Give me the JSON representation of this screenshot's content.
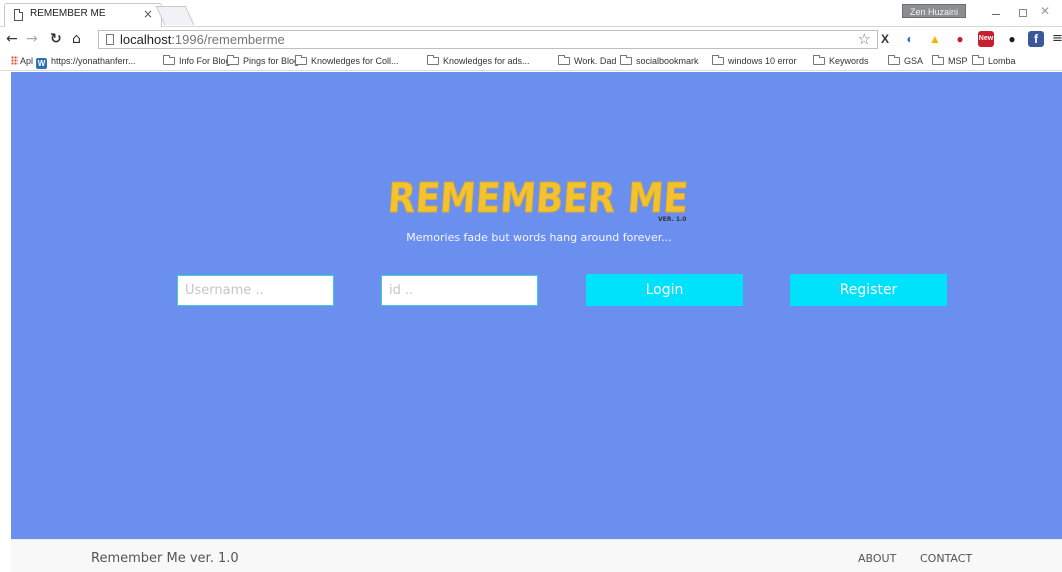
{
  "browser": {
    "tab_title": "REMEMBER ME",
    "tab_close": "×",
    "profile_name": "Zen Huzaini",
    "url_host": "localhost",
    "url_path": ":1996/rememberme",
    "extensions": [
      {
        "icon": "x-extension-icon",
        "glyph": "X",
        "color": "#333333"
      },
      {
        "icon": "user-extension-icon",
        "glyph": "◐",
        "color": "#2a6fd1"
      },
      {
        "icon": "google-drive-icon",
        "glyph": "▲",
        "color": "#f4b400"
      },
      {
        "icon": "ublock-shield-icon",
        "glyph": "●",
        "color": "#c81e2c"
      },
      {
        "icon": "new-extension-icon",
        "glyph": "New",
        "color": "#c81e2c"
      },
      {
        "icon": "color-wheel-icon",
        "glyph": "●",
        "color": "#1e1e1e"
      },
      {
        "icon": "facebook-icon",
        "glyph": "f",
        "color": "#3b5998"
      }
    ]
  },
  "bookmarks": {
    "apps_label": "Apl",
    "items": [
      {
        "label": "https://yonathanferr...",
        "icon": "wordpress-icon"
      },
      {
        "label": "Info For Blog",
        "icon": "folder-icon"
      },
      {
        "label": "Pings for Blog",
        "icon": "folder-icon"
      },
      {
        "label": "Knowledges for Coll...",
        "icon": "folder-icon"
      },
      {
        "label": "Knowledges for ads...",
        "icon": "folder-icon"
      },
      {
        "label": "Work. Dad",
        "icon": "folder-icon"
      },
      {
        "label": "socialbookmark",
        "icon": "folder-icon"
      },
      {
        "label": "windows 10 error",
        "icon": "folder-icon"
      },
      {
        "label": "Keywords",
        "icon": "folder-icon"
      },
      {
        "label": "GSA",
        "icon": "folder-icon"
      },
      {
        "label": "MSP",
        "icon": "folder-icon"
      },
      {
        "label": "Lomba",
        "icon": "folder-icon"
      }
    ]
  },
  "page": {
    "background_color": "#6b8fef",
    "accent_color": "#00e1fb",
    "logo_color": "#f2c230",
    "logo_text": "REMEMBER ME",
    "logo_version": "VER. 1.0",
    "tagline": "Memories fade but words hang around forever...",
    "form": {
      "username_placeholder": "Username ..",
      "username_value": "",
      "id_placeholder": "id ..",
      "id_value": "",
      "login_label": "Login",
      "register_label": "Register"
    }
  },
  "footer": {
    "brand": "Remember Me ver. 1.0",
    "links": [
      "ABOUT",
      "CONTACT"
    ]
  }
}
